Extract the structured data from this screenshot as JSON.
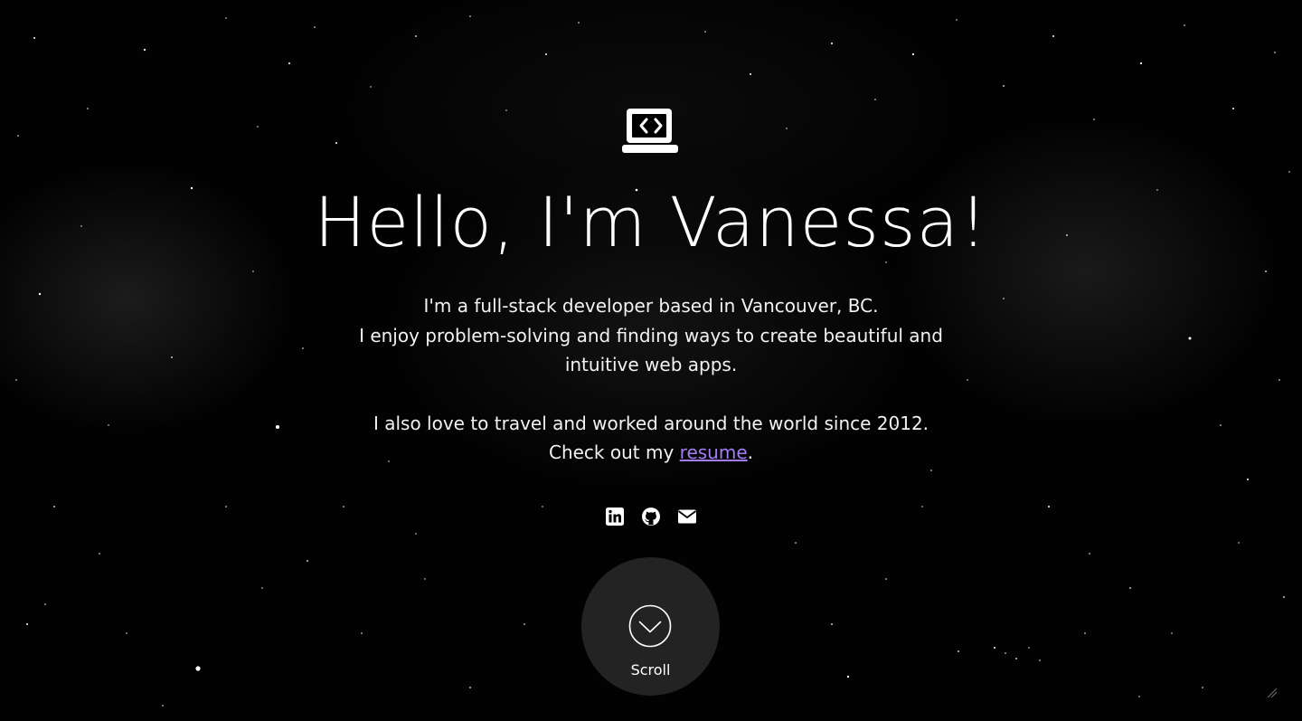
{
  "hero": {
    "title": "Hello, I'm Vanessa!",
    "bio_line1": "I'm a full-stack developer based in Vancouver, BC.",
    "bio_line2": "I enjoy problem-solving and finding ways to create beautiful and intuitive web apps.",
    "bio_line3": "I also love to travel and worked around the world since 2012.",
    "bio_line4_prefix": "Check out my ",
    "resume_link_text": "resume",
    "bio_line4_suffix": ".",
    "logo_icon": "laptop-code-icon"
  },
  "socials": [
    {
      "name": "LinkedIn",
      "icon": "linkedin-icon"
    },
    {
      "name": "GitHub",
      "icon": "github-icon"
    },
    {
      "name": "Email",
      "icon": "envelope-icon"
    }
  ],
  "scroll": {
    "label": "Scroll",
    "icon": "chevron-down-circle-icon"
  },
  "colors": {
    "background": "#000000",
    "text": "#ffffff",
    "link": "#a27df5",
    "scroll_circle": "#262626"
  }
}
